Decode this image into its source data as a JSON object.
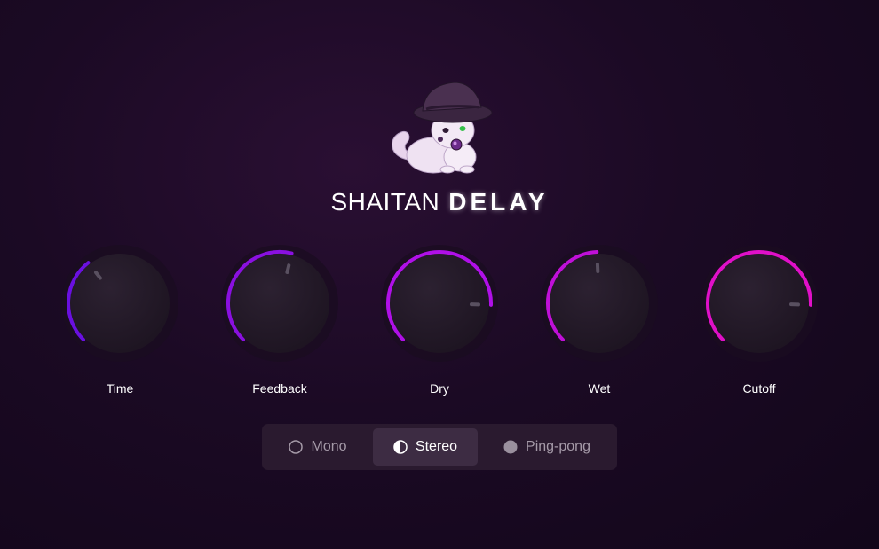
{
  "app": {
    "title_light": "SHAITAN",
    "title_bold": "DELAY"
  },
  "colors": {
    "background": "#1b0a24",
    "knob_face": "#241a29",
    "mode_bar": "#2a1a2f",
    "mode_active": "#3d2c43"
  },
  "knobs": [
    {
      "id": "time",
      "label": "Time",
      "value": 0.36,
      "color": "#6a10e0",
      "icon": "knob"
    },
    {
      "id": "feedback",
      "label": "Feedback",
      "value": 0.55,
      "color": "#8a10e0",
      "icon": "knob"
    },
    {
      "id": "dry",
      "label": "Dry",
      "value": 0.84,
      "color": "#b010e8",
      "icon": "knob"
    },
    {
      "id": "wet",
      "label": "Wet",
      "value": 0.49,
      "color": "#c010d8",
      "icon": "knob"
    },
    {
      "id": "cutoff",
      "label": "Cutoff",
      "value": 0.84,
      "color": "#e010c8",
      "icon": "knob"
    }
  ],
  "modes": {
    "selected": "Stereo",
    "options": [
      {
        "label": "Mono",
        "icon": "circle-outline-icon"
      },
      {
        "label": "Stereo",
        "icon": "half-circle-icon"
      },
      {
        "label": "Ping-pong",
        "icon": "filled-circle-icon"
      }
    ]
  }
}
